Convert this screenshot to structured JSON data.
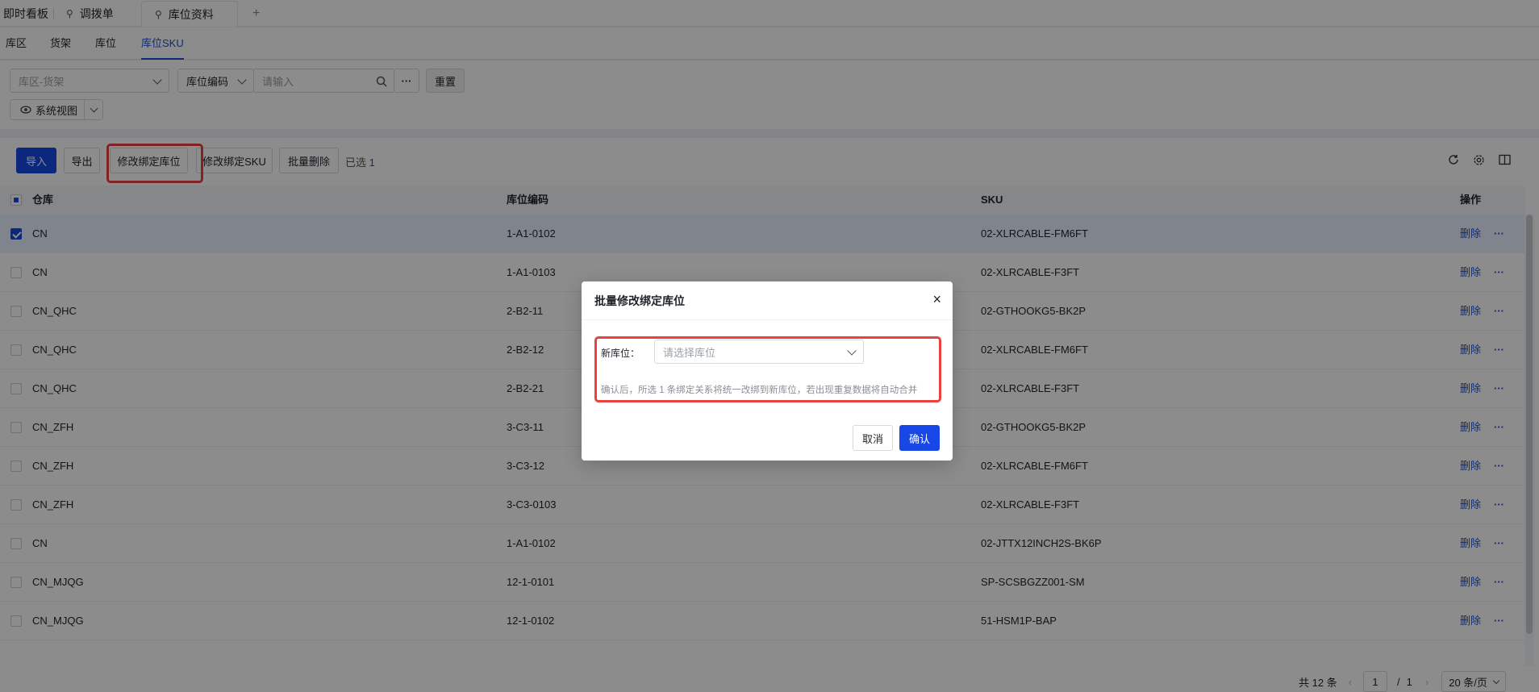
{
  "top_tabs": [
    {
      "label": "即时看板"
    },
    {
      "label": "调拨单"
    },
    {
      "label": "库位资料"
    }
  ],
  "add_tab": "+",
  "sub_tabs": [
    {
      "label": "库区"
    },
    {
      "label": "货架"
    },
    {
      "label": "库位"
    },
    {
      "label": "库位SKU"
    }
  ],
  "filters": {
    "zone_shelf_placeholder": "库区-货架",
    "field_select": "库位编码",
    "search_placeholder": "请输入",
    "more": "···",
    "reset": "重置",
    "view": "系统视图"
  },
  "toolbar": {
    "import": "导入",
    "export": "导出",
    "modify_location": "修改绑定库位",
    "modify_sku": "修改绑定SKU",
    "batch_delete": "批量删除",
    "selected_prefix": "已选",
    "selected_count": "1"
  },
  "table": {
    "headers": [
      "仓库",
      "库位编码",
      "SKU",
      "操作"
    ],
    "delete_label": "删除",
    "more_label": "···",
    "rows": [
      {
        "warehouse": "CN",
        "code": "1-A1-0102",
        "sku": "02-XLRCABLE-FM6FT",
        "checked": true
      },
      {
        "warehouse": "CN",
        "code": "1-A1-0103",
        "sku": "02-XLRCABLE-F3FT",
        "checked": false
      },
      {
        "warehouse": "CN_QHC",
        "code": "2-B2-11",
        "sku": "02-GTHOOKG5-BK2P",
        "checked": false
      },
      {
        "warehouse": "CN_QHC",
        "code": "2-B2-12",
        "sku": "02-XLRCABLE-FM6FT",
        "checked": false
      },
      {
        "warehouse": "CN_QHC",
        "code": "2-B2-21",
        "sku": "02-XLRCABLE-F3FT",
        "checked": false
      },
      {
        "warehouse": "CN_ZFH",
        "code": "3-C3-11",
        "sku": "02-GTHOOKG5-BK2P",
        "checked": false
      },
      {
        "warehouse": "CN_ZFH",
        "code": "3-C3-12",
        "sku": "02-XLRCABLE-FM6FT",
        "checked": false
      },
      {
        "warehouse": "CN_ZFH",
        "code": "3-C3-0103",
        "sku": "02-XLRCABLE-F3FT",
        "checked": false
      },
      {
        "warehouse": "CN",
        "code": "1-A1-0102",
        "sku": "02-JTTX12INCH2S-BK6P",
        "checked": false
      },
      {
        "warehouse": "CN_MJQG",
        "code": "12-1-0101",
        "sku": "SP-SCSBGZZ001-SM",
        "checked": false
      },
      {
        "warehouse": "CN_MJQG",
        "code": "12-1-0102",
        "sku": "51-HSM1P-BAP",
        "checked": false
      }
    ]
  },
  "pagination": {
    "total": "共 12 条",
    "current": "1",
    "divider": "/",
    "pages": "1",
    "page_size": "20 条/页"
  },
  "dialog": {
    "title": "批量修改绑定库位",
    "close": "×",
    "field_label": "新库位：",
    "field_placeholder": "请选择库位",
    "hint": "确认后，所选 1 条绑定关系将统一改绑到新库位，若出现重复数据将自动合并",
    "cancel": "取消",
    "confirm": "确认"
  },
  "colors": {
    "primary": "#1747e6",
    "highlight": "#e8423f"
  }
}
